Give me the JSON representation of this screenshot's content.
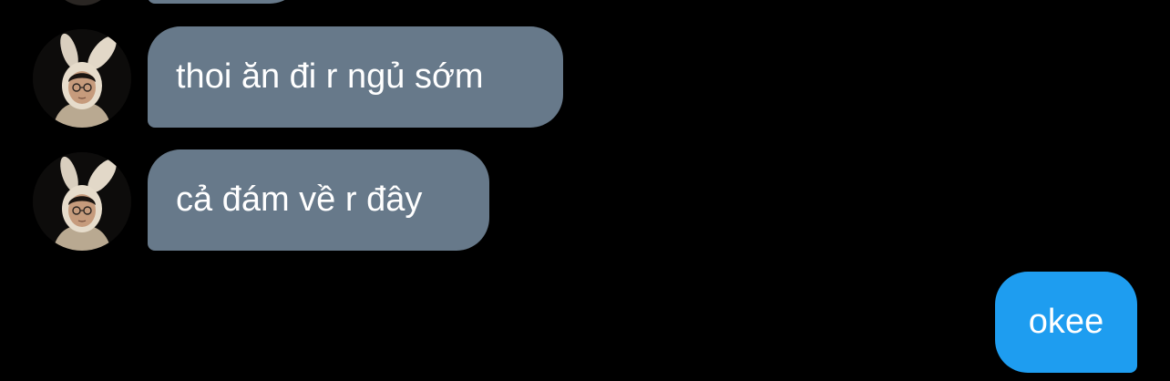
{
  "messages": [
    {
      "sender": "other",
      "text": "thoi ăn đi r ngủ sớm"
    },
    {
      "sender": "other",
      "text": "cả đám về r đây"
    },
    {
      "sender": "me",
      "text": "okee"
    }
  ],
  "colors": {
    "background": "#000000",
    "incoming_bubble": "#67798a",
    "outgoing_bubble": "#1e9df0",
    "text": "#ffffff"
  },
  "icons": [
    "user-avatar-icon"
  ]
}
